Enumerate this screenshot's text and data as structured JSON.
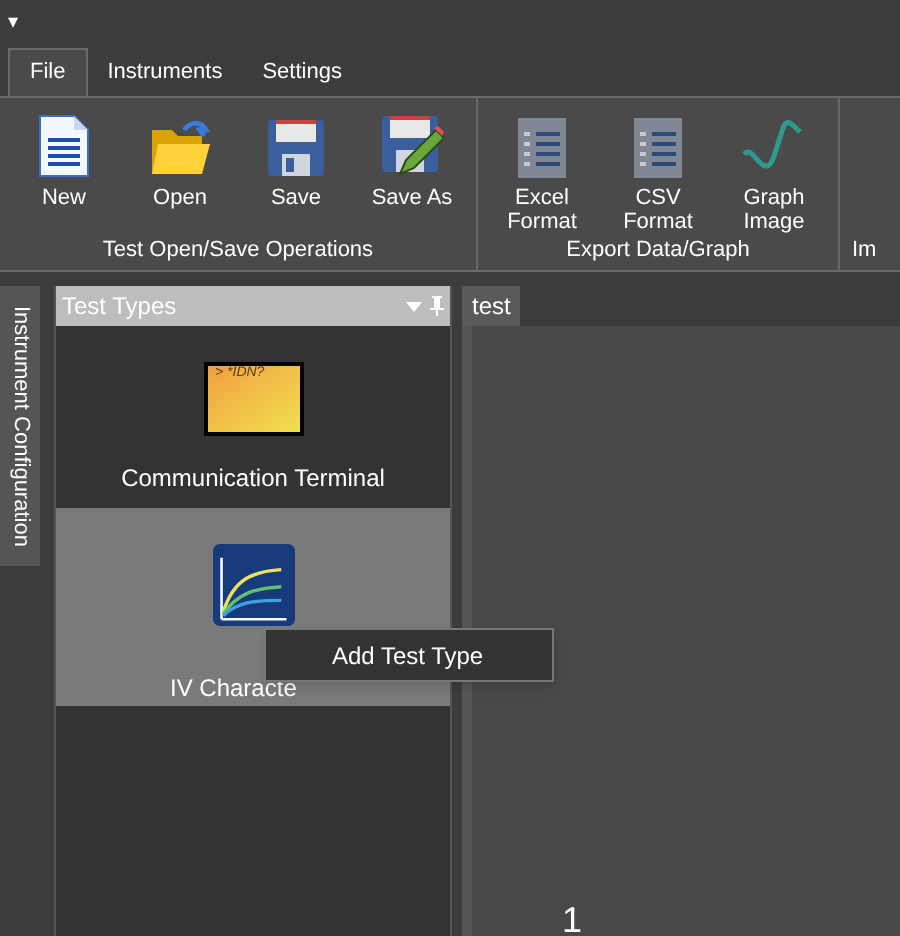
{
  "quick_access": {
    "glyph": "▾"
  },
  "tabs": [
    {
      "label": "File",
      "selected": true
    },
    {
      "label": "Instruments",
      "selected": false
    },
    {
      "label": "Settings",
      "selected": false
    }
  ],
  "ribbon_groups": [
    {
      "label": "Test Open/Save Operations",
      "buttons": [
        {
          "label": "New",
          "kind": "new"
        },
        {
          "label": "Open",
          "kind": "open"
        },
        {
          "label": "Save",
          "kind": "save"
        },
        {
          "label": "Save As",
          "kind": "saveas"
        }
      ]
    },
    {
      "label": "Export Data/Graph",
      "buttons": [
        {
          "label": "Excel Format",
          "kind": "doc"
        },
        {
          "label": "CSV Format",
          "kind": "doc"
        },
        {
          "label": "Graph Image",
          "kind": "graph"
        }
      ]
    },
    {
      "label": "Im"
    }
  ],
  "side_tab": "Instrument Configuration",
  "panel": {
    "title": "Test Types",
    "items": [
      {
        "label": "Communication Terminal",
        "kind": "terminal",
        "terminal_text": "> *IDN?",
        "selected": false
      },
      {
        "label": "IV Characte",
        "kind": "iv",
        "selected": true
      }
    ]
  },
  "context_menu": {
    "items": [
      "Add Test Type"
    ]
  },
  "document_tab": "test",
  "document_text": "1"
}
